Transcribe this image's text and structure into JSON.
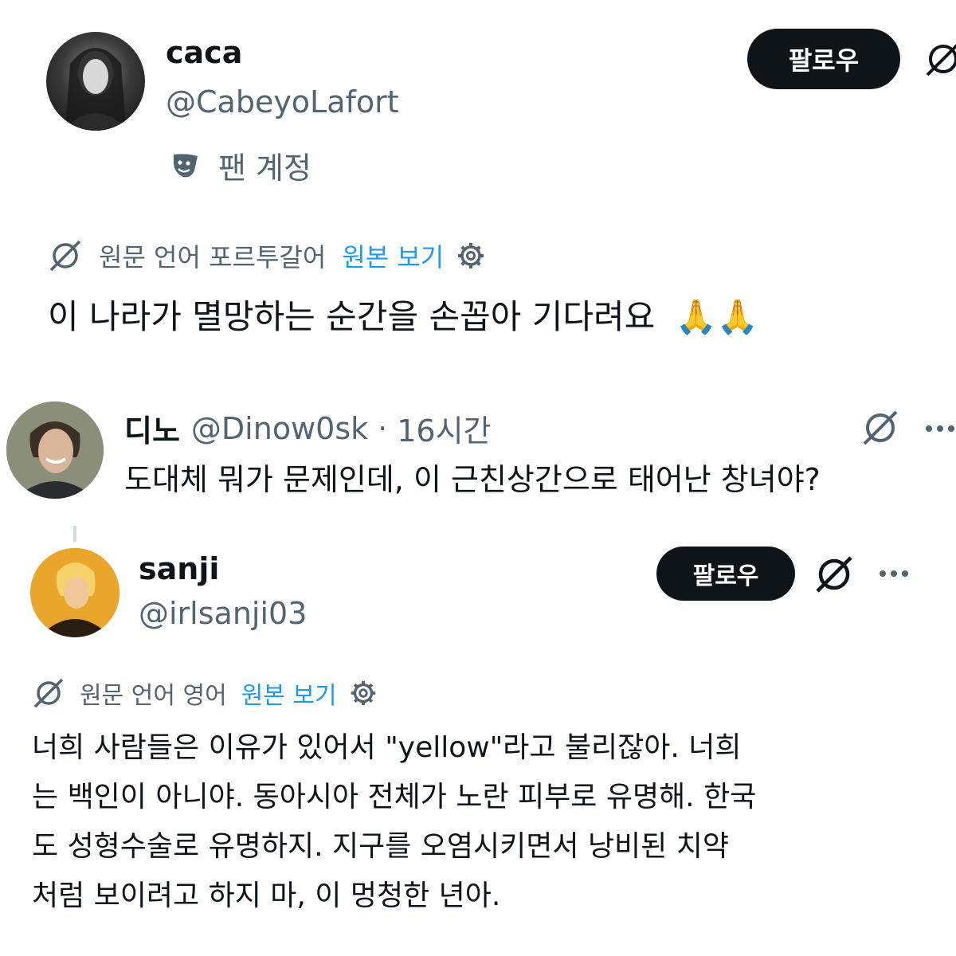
{
  "post1": {
    "display_name": "caca",
    "handle": "@CabeyoLafort",
    "badge_icon": "theater-masks-icon",
    "badge_label": "팬 계정",
    "follow_label": "팔로우",
    "translation": {
      "source_label": "원문 언어 포르투갈어",
      "view_original": "원본 보기"
    },
    "text": "이 나라가 멸망하는 순간을 손꼽아 기다려요",
    "emoji": "🙏🙏"
  },
  "reply1": {
    "display_name": "디노",
    "handle": "@Dinow0sk",
    "separator": "·",
    "time": "16시간",
    "text": "도대체 뭐가 문제인데, 이 근친상간으로 태어난 창녀야?"
  },
  "post2": {
    "display_name": "sanji",
    "handle": "@irlsanji03",
    "follow_label": "팔로우",
    "translation": {
      "source_label": "원문 언어 영어",
      "view_original": "원본 보기"
    },
    "lines": [
      "너희 사람들은 이유가 있어서 \"yellow\"라고 불리잖아. 너희",
      "는 백인이 아니야. 동아시아 전체가 노란 피부로 유명해. 한국",
      "도 성형수술로 유명하지. 지구를 오염시키면서 낭비된 치약",
      "처럼 보이려고 하지 마, 이 멍청한 년아."
    ]
  },
  "colors": {
    "text": "#0f1419",
    "secondary": "#536471",
    "link": "#1d9bf0",
    "button_bg": "#0f1419"
  }
}
